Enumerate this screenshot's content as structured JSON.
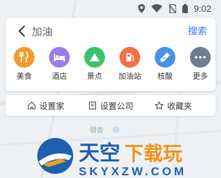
{
  "status_bar": {
    "time": "9:02",
    "icons": [
      "location-icon",
      "wifi-icon",
      "no-sim-icon",
      "battery-icon"
    ]
  },
  "search": {
    "query": "加油",
    "action_label": "搜索"
  },
  "categories": [
    {
      "label": "美食",
      "icon": "fork-knife-icon",
      "color": "#f39a2b"
    },
    {
      "label": "酒店",
      "icon": "bed-icon",
      "color": "#9b7be8"
    },
    {
      "label": "景点",
      "icon": "mountain-icon",
      "color": "#3cc46a"
    },
    {
      "label": "加油站",
      "icon": "fuel-pump-icon",
      "color": "#f56f4a"
    },
    {
      "label": "核酸",
      "icon": "test-tube-icon",
      "color": "#4a90e8"
    },
    {
      "label": "更多",
      "icon": "more-dots-icon",
      "color": "#6f7c91"
    }
  ],
  "shortcuts": {
    "home": "设置家",
    "company": "设置公司",
    "favorites": "收藏夹"
  },
  "map": {
    "label": "银杏"
  },
  "watermark": {
    "text_main": "天空",
    "text_accent": "下载玩",
    "url": "SKYXZW.COM"
  }
}
